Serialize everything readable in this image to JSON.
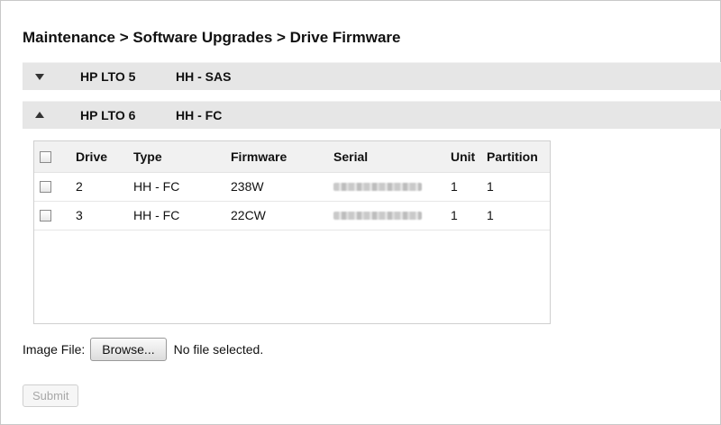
{
  "breadcrumb": "Maintenance > Software Upgrades > Drive Firmware",
  "groups": [
    {
      "name": "HP LTO 5",
      "type": "HH - SAS",
      "expanded": false
    },
    {
      "name": "HP LTO 6",
      "type": "HH - FC",
      "expanded": true
    }
  ],
  "table": {
    "columns": [
      "Drive",
      "Type",
      "Firmware",
      "Serial",
      "Unit",
      "Partition"
    ],
    "rows": [
      {
        "drive": "2",
        "type": "HH - FC",
        "firmware": "238W",
        "serial_obscured": true,
        "unit": "1",
        "partition": "1"
      },
      {
        "drive": "3",
        "type": "HH - FC",
        "firmware": "22CW",
        "serial_obscured": true,
        "unit": "1",
        "partition": "1"
      }
    ]
  },
  "upload": {
    "label": "Image File:",
    "browse_label": "Browse...",
    "status": "No file selected.",
    "submit_label": "Submit",
    "submit_enabled": false
  }
}
